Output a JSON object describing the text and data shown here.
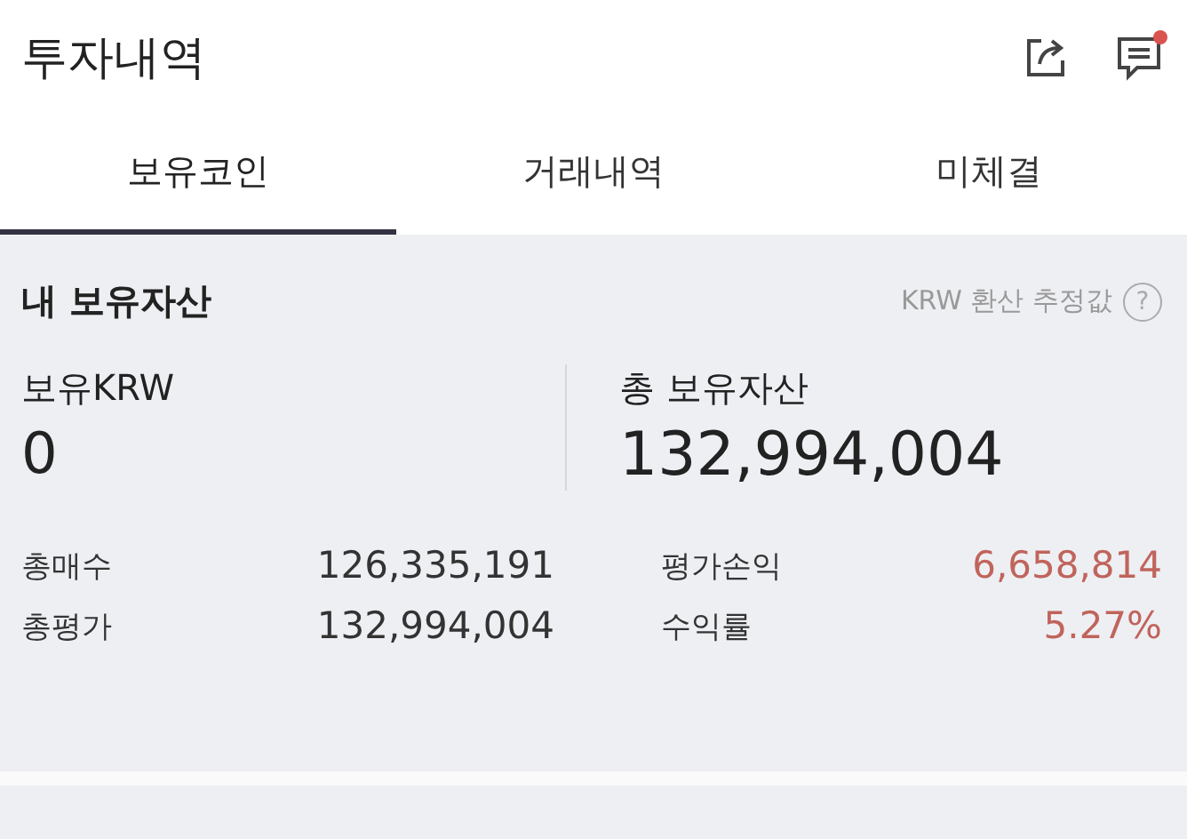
{
  "header": {
    "title": "투자내역",
    "notification": true
  },
  "tabs": [
    {
      "label": "보유코인",
      "selected": true
    },
    {
      "label": "거래내역",
      "selected": false
    },
    {
      "label": "미체결",
      "selected": false
    }
  ],
  "assets": {
    "title": "내 보유자산",
    "note": "KRW 환산 추정값",
    "help": "?",
    "krw": {
      "label": "보유KRW",
      "value": "0"
    },
    "total": {
      "label": "총 보유자산",
      "value": "132,994,004"
    },
    "stats": [
      {
        "label": "총매수",
        "value": "126,335,191",
        "color": "#333333"
      },
      {
        "label": "평가손익",
        "value": "6,658,814",
        "color": "#c0645c"
      },
      {
        "label": "총평가",
        "value": "132,994,004",
        "color": "#333333"
      },
      {
        "label": "수익률",
        "value": "5.27%",
        "color": "#c0645c"
      }
    ]
  }
}
